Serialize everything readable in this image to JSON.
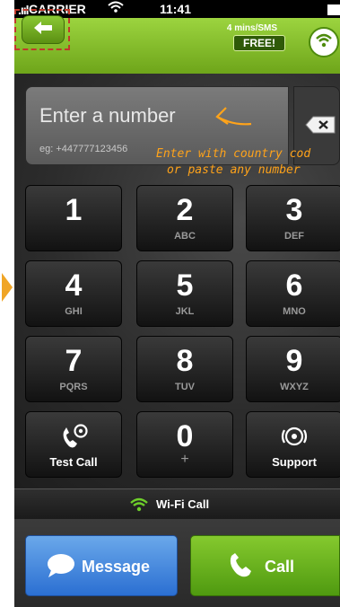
{
  "status_bar": {
    "signal": ".ııl",
    "carrier": "CARRIER",
    "time": "11:41"
  },
  "header": {
    "back_icon": "arrow-left-icon",
    "promo_text": "4 mins/SMS",
    "promo_badge": "FREE!",
    "wifi_icon": "wifi-icon"
  },
  "number_entry": {
    "placeholder": "Enter a number",
    "example": "eg: +447777123456",
    "hint_line1": "Enter with country cod",
    "hint_line2": "or paste any number"
  },
  "keypad": {
    "keys": [
      {
        "digit": "1",
        "letters": ""
      },
      {
        "digit": "2",
        "letters": "ABC"
      },
      {
        "digit": "3",
        "letters": "DEF"
      },
      {
        "digit": "4",
        "letters": "GHI"
      },
      {
        "digit": "5",
        "letters": "JKL"
      },
      {
        "digit": "6",
        "letters": "MNO"
      },
      {
        "digit": "7",
        "letters": "PQRS"
      },
      {
        "digit": "8",
        "letters": "TUV"
      },
      {
        "digit": "9",
        "letters": "WXYZ"
      },
      {
        "digit": "0",
        "letters": "+"
      }
    ],
    "test_call_label": "Test Call",
    "support_label": "Support"
  },
  "wifi_call": {
    "label": "Wi-Fi Call"
  },
  "actions": {
    "message_label": "Message",
    "call_label": "Call"
  },
  "colors": {
    "header_green": "#8ac43a",
    "hint_orange": "#ffa31a",
    "message_blue": "#3f86de",
    "call_green": "#6db425",
    "annotation_red": "#c0392b"
  }
}
